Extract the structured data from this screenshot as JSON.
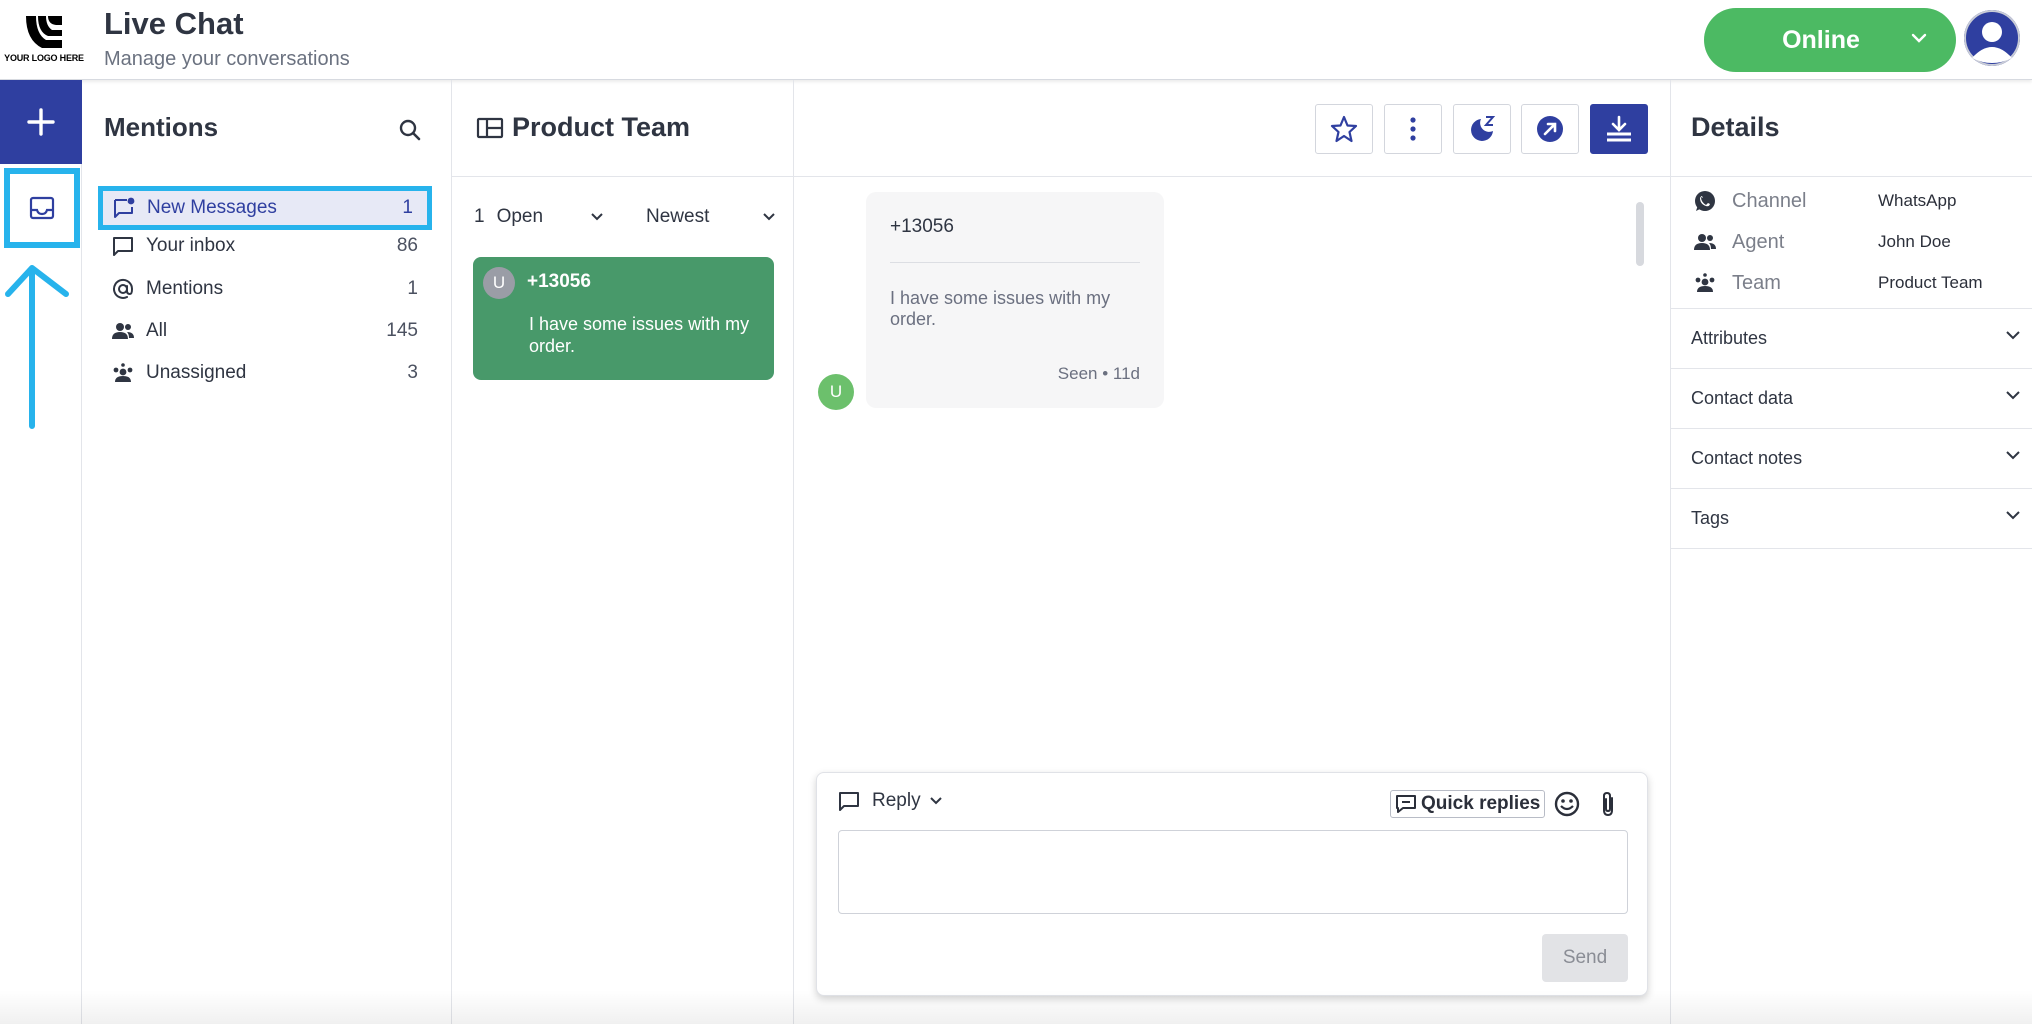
{
  "header": {
    "logo_text": "YOUR LOGO HERE",
    "title": "Live Chat",
    "subtitle": "Manage your conversations",
    "status_label": "Online",
    "status_color": "#4cba63"
  },
  "colors": {
    "brand": "#2f3fa0",
    "highlight": "#27b3ec",
    "card": "#48996a"
  },
  "rail": {
    "new_icon": "plus-icon",
    "inbox_icon": "inbox-tray-icon"
  },
  "mentions": {
    "title": "Mentions",
    "items": [
      {
        "label": "New Messages",
        "count": "1",
        "icon": "new-message-icon"
      },
      {
        "label": "Your inbox",
        "count": "86",
        "icon": "chat-bubble-icon"
      },
      {
        "label": "Mentions",
        "count": "1",
        "icon": "at-icon"
      },
      {
        "label": "All",
        "count": "145",
        "icon": "users-icon"
      },
      {
        "label": "Unassigned",
        "count": "3",
        "icon": "group-icon"
      }
    ]
  },
  "conversations": {
    "team_title": "Product Team",
    "filter_count": "1",
    "filter_status": "Open",
    "sort": "Newest",
    "items": [
      {
        "initial": "U",
        "name": "+13056",
        "preview": "I have some issues with my order."
      }
    ]
  },
  "chat": {
    "toolbar": [
      "star-icon",
      "more-vertical-icon",
      "snooze-icon",
      "forward-icon",
      "download-icon"
    ],
    "message": {
      "sender": "+13056",
      "text": "I have some issues with my order.",
      "meta": "Seen • 11d",
      "avatar_initial": "U"
    },
    "reply": {
      "mode": "Reply",
      "quick_replies": "Quick replies",
      "placeholder": "",
      "send": "Send"
    }
  },
  "details": {
    "title": "Details",
    "rows": [
      {
        "key": "Channel",
        "value": "WhatsApp",
        "icon": "whatsapp-icon"
      },
      {
        "key": "Agent",
        "value": "John Doe",
        "icon": "users-icon"
      },
      {
        "key": "Team",
        "value": "Product Team",
        "icon": "group-icon"
      }
    ],
    "sections": [
      "Attributes",
      "Contact data",
      "Contact notes",
      "Tags"
    ]
  }
}
